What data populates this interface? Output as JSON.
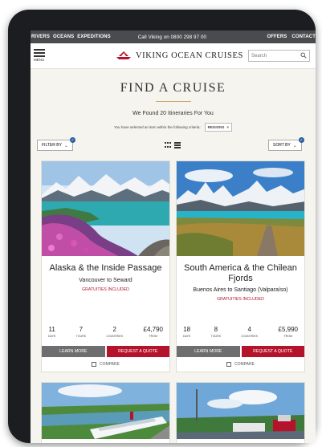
{
  "topbar": {
    "nav": [
      "RIVERS",
      "OCEANS",
      "EXPEDITIONS"
    ],
    "call": "Call Viking on 0800 298 97 00",
    "right": [
      "OFFERS",
      "CONTACT"
    ]
  },
  "header": {
    "menu_label": "MENU",
    "brand": "VIKING OCEAN CRUISES",
    "search_placeholder": "Search"
  },
  "page": {
    "title": "FIND A CRUISE",
    "found": "We Found 20 Itineraries For You",
    "criteria_text": "You have selected an item within the following criteria:",
    "criteria_chip": "REGIONS",
    "chip_close": "×"
  },
  "filters": {
    "filter_label": "FILTER BY",
    "sort_label": "SORT BY",
    "check": "✓"
  },
  "cruises": [
    {
      "title": "Alaska & the Inside Passage",
      "route": "Vancouver to Seward",
      "gratuities": "GRATUITIES INCLUDED",
      "stats": [
        {
          "value": "11",
          "unit": "DAYS"
        },
        {
          "value": "7",
          "unit": "TOURS"
        },
        {
          "value": "2",
          "unit": "COUNTRIES"
        },
        {
          "value": "£4,790",
          "unit": "FROM"
        }
      ],
      "learn_more": "LEARN MORE",
      "quote": "REQUEST A QUOTE",
      "compare": "COMPARE"
    },
    {
      "title": "South America & the Chilean Fjords",
      "route": "Buenos Aires to Santiago (Valparaíso)",
      "gratuities": "GRATUITIES INCLUDED",
      "stats": [
        {
          "value": "18",
          "unit": "DAYS"
        },
        {
          "value": "8",
          "unit": "TOURS"
        },
        {
          "value": "4",
          "unit": "COUNTRIES"
        },
        {
          "value": "£5,990",
          "unit": "FROM"
        }
      ],
      "learn_more": "LEARN MORE",
      "quote": "REQUEST A QUOTE",
      "compare": "COMPARE"
    }
  ],
  "colors": {
    "accent_red": "#b5132b",
    "button_grey": "#6e6e70",
    "badge_blue": "#2a5f9e"
  }
}
